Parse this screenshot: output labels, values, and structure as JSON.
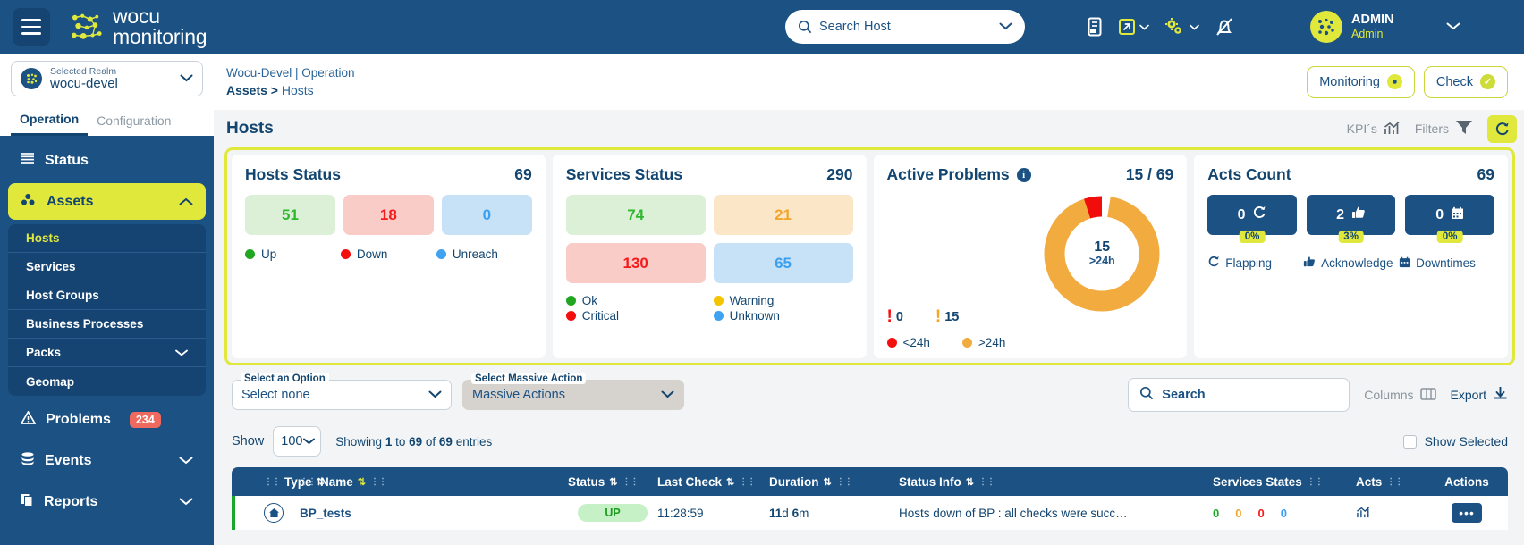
{
  "topbar": {
    "brand_line1": "wocu",
    "brand_line2": "monitoring",
    "search_placeholder": "Search Host",
    "user_name": "ADMIN",
    "user_role": "Admin"
  },
  "sidebar": {
    "realm_label": "Selected Realm",
    "realm_value": "wocu-devel",
    "tabs": [
      {
        "label": "Operation",
        "active": true
      },
      {
        "label": "Configuration",
        "active": false
      }
    ],
    "items": [
      {
        "label": "Status"
      },
      {
        "label": "Assets"
      },
      {
        "label": "Problems",
        "badge": "234"
      },
      {
        "label": "Events"
      },
      {
        "label": "Reports"
      }
    ],
    "assets_children": [
      {
        "label": "Hosts",
        "selected": true
      },
      {
        "label": "Services"
      },
      {
        "label": "Host Groups"
      },
      {
        "label": "Business Processes"
      },
      {
        "label": "Packs",
        "expandable": true
      },
      {
        "label": "Geomap"
      }
    ]
  },
  "breadcrumb": {
    "line1": "Wocu-Devel | Operation",
    "line2_first": "Assets",
    "line2_sep": " > ",
    "line2_last": "Hosts",
    "monitoring_btn": "Monitoring",
    "check_btn": "Check"
  },
  "page": {
    "title": "Hosts",
    "kpis_label": "KPI´s",
    "filters_label": "Filters"
  },
  "cards": {
    "hosts_status": {
      "title": "Hosts Status",
      "count": "69",
      "tiles": [
        {
          "value": "51",
          "color": "green"
        },
        {
          "value": "18",
          "color": "red"
        },
        {
          "value": "0",
          "color": "blue"
        }
      ],
      "legend": [
        {
          "label": "Up",
          "color": "green"
        },
        {
          "label": "Down",
          "color": "red"
        },
        {
          "label": "Unreach",
          "color": "blue"
        }
      ]
    },
    "services_status": {
      "title": "Services Status",
      "count": "290",
      "tiles": [
        {
          "value": "74",
          "color": "green"
        },
        {
          "value": "21",
          "color": "orange"
        },
        {
          "value": "130",
          "color": "red"
        },
        {
          "value": "65",
          "color": "blue"
        }
      ],
      "legend": [
        {
          "label": "Ok",
          "color": "green"
        },
        {
          "label": "Warning",
          "color": "yellow"
        },
        {
          "label": "Critical",
          "color": "red"
        },
        {
          "label": "Unknown",
          "color": "blue"
        }
      ]
    },
    "active_problems": {
      "title": "Active Problems",
      "count": "15 / 69",
      "stat_lt24": "0",
      "stat_gt24": "15",
      "donut_value": "15",
      "donut_label": ">24h",
      "legend": [
        {
          "label": "<24h",
          "color": "red"
        },
        {
          "label": ">24h",
          "color": "orange"
        }
      ]
    },
    "acts_count": {
      "title": "Acts Count",
      "count": "69",
      "tiles": [
        {
          "value": "0",
          "pct": "0%",
          "icon": "flapping-icon"
        },
        {
          "value": "2",
          "pct": "3%",
          "icon": "thumbs-up-icon"
        },
        {
          "value": "0",
          "pct": "0%",
          "icon": "calendar-icon"
        }
      ],
      "legend": [
        {
          "label": "Flapping"
        },
        {
          "label": "Acknowledge"
        },
        {
          "label": "Downtimes"
        }
      ]
    }
  },
  "controls": {
    "select_option_label": "Select an Option",
    "select_option_value": "Select none",
    "massive_action_label": "Select Massive Action",
    "massive_action_value": "Massive Actions",
    "search_label": "Search",
    "columns_label": "Columns",
    "export_label": "Export"
  },
  "pagination": {
    "show_label": "Show",
    "show_value": "100",
    "showing_prefix": "Showing ",
    "showing_from": "1",
    "showing_mid": " to ",
    "showing_to": "69",
    "showing_of": " of ",
    "showing_total": "69",
    "showing_suffix": " entries",
    "show_selected_label": "Show Selected"
  },
  "table": {
    "columns": [
      {
        "label": "Type",
        "sorted": false
      },
      {
        "label": "Name",
        "sorted": true
      },
      {
        "label": "Status",
        "sorted": false
      },
      {
        "label": "Last Check",
        "sorted": false
      },
      {
        "label": "Duration",
        "sorted": false
      },
      {
        "label": "Status Info",
        "sorted": false
      },
      {
        "label": "Services States",
        "sorted": null
      },
      {
        "label": "Acts",
        "sorted": null
      },
      {
        "label": "Actions",
        "sorted": null
      }
    ],
    "rows": [
      {
        "name": "BP_tests",
        "status": "UP",
        "last_check": "11:28:59",
        "duration_d": "11",
        "duration_d_u": "d",
        "duration_m": "6",
        "duration_m_u": "m",
        "status_info": "Hosts down of BP : all checks were succ…",
        "services": [
          "0",
          "0",
          "0",
          "0"
        ],
        "actions": "•••"
      }
    ]
  },
  "colors": {
    "brand_navy": "#1b5183",
    "brand_lime": "#e0e83c",
    "ok_green": "#2eb82e",
    "critical_red": "#f51b1b",
    "warning_orange": "#f0a62e",
    "unknown_blue": "#3ca0f0"
  }
}
